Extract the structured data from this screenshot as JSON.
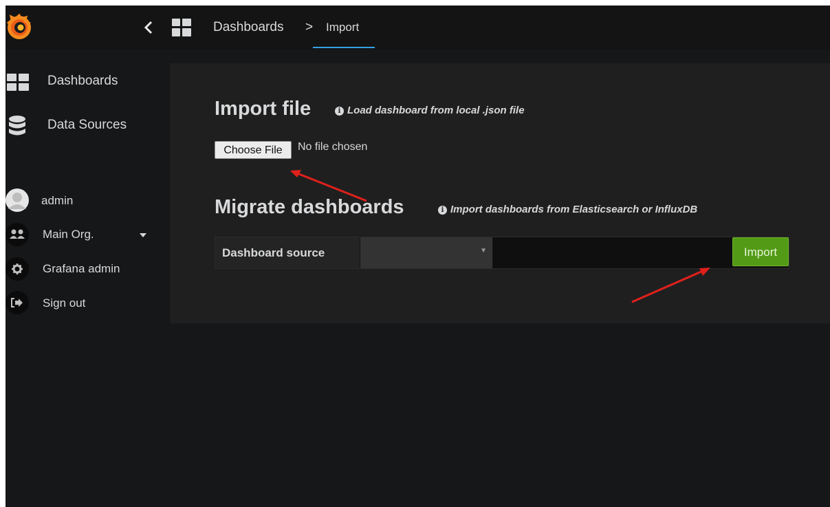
{
  "colors": {
    "accent_underline": "#33a2e5",
    "import_button": "#539b16",
    "arrow": "#e0201b"
  },
  "topbar": {
    "logo_icon": "grafana-logo-icon",
    "back_icon": "chevron-left-icon",
    "dashboards_icon": "dashboards-grid-icon",
    "breadcrumb": {
      "parent": "Dashboards",
      "separator": ">",
      "current": "Import"
    }
  },
  "sidebar": {
    "nav": [
      {
        "icon": "dashboards-grid-icon",
        "label": "Dashboards"
      },
      {
        "icon": "database-icon",
        "label": "Data Sources"
      }
    ],
    "user": [
      {
        "icon": "avatar-icon",
        "label": "admin"
      },
      {
        "icon": "users-icon",
        "label": "Main Org."
      },
      {
        "icon": "gear-icon",
        "label": "Grafana admin"
      },
      {
        "icon": "sign-out-icon",
        "label": "Sign out"
      }
    ]
  },
  "import_file": {
    "title": "Import file",
    "hint": "Load dashboard from local .json file",
    "choose_button": "Choose File",
    "no_file": "No file chosen"
  },
  "migrate": {
    "title": "Migrate dashboards",
    "hint": "Import dashboards from Elasticsearch or InfluxDB",
    "source_label": "Dashboard source",
    "source_value": "",
    "input_value": "",
    "import_button": "Import"
  }
}
